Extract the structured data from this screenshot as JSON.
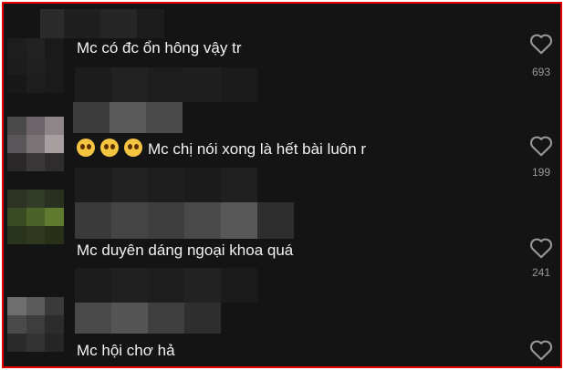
{
  "colors": {
    "background": "#141414",
    "text": "#f2f2f2",
    "count": "#9a9a9a",
    "frame": "#e60000"
  },
  "comments": [
    {
      "text": "Mc có đc ổn hông vậy tr",
      "likes": "693",
      "emoji_count": 0
    },
    {
      "text": "Mc chị nói xong là hết bài luôn r",
      "likes": "199",
      "emoji_count": 3,
      "emoji": "pleading-face-icon"
    },
    {
      "text": "Mc duyên dáng ngoại khoa quá",
      "likes": "241",
      "emoji_count": 0
    },
    {
      "text": "Mc hội chơ hả",
      "likes": "",
      "emoji_count": 0
    }
  ]
}
